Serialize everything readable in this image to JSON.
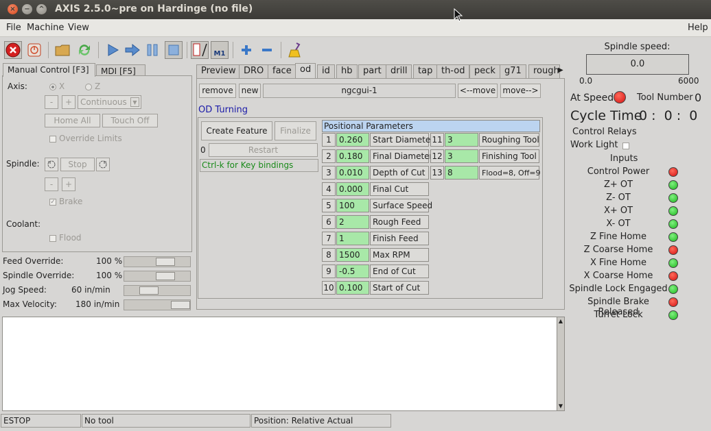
{
  "window": {
    "title": "AXIS 2.5.0~pre on Hardinge (no file)",
    "close": "×",
    "minimize": "−",
    "maximize": "^"
  },
  "menu": {
    "file": "File",
    "machine": "Machine",
    "view": "View",
    "help": "Help"
  },
  "toolbar": {
    "touch_off_label": "M1"
  },
  "left": {
    "tabs": [
      "Manual Control [F3]",
      "MDI [F5]"
    ],
    "axis_label": "Axis:",
    "axis_x": "X",
    "axis_z": "Z",
    "minus": "-",
    "plus": "+",
    "jog_mode": "Continuous",
    "home_all": "Home All",
    "touch_off": "Touch Off",
    "override_limits": "Override Limits",
    "spindle_label": "Spindle:",
    "stop": "Stop",
    "brake": "Brake",
    "coolant_label": "Coolant:",
    "flood": "Flood",
    "check_mark": "✓"
  },
  "overrides": [
    {
      "label": "Feed Override:",
      "value": "100 %"
    },
    {
      "label": "Spindle Override:",
      "value": "100 %"
    },
    {
      "label": "Jog Speed:",
      "value": "60 in/min"
    },
    {
      "label": "Max Velocity:",
      "value": "180 in/min"
    }
  ],
  "center": {
    "tabs": [
      "Preview",
      "DRO",
      "face",
      "od",
      "id",
      "hb",
      "part",
      "drill",
      "tap",
      "th-od",
      "peck",
      "g71",
      "rough"
    ],
    "remove": "remove",
    "new": "new",
    "title_entry": "ngcgui-1",
    "move_left": "<--move",
    "move_right": "move-->",
    "section": "OD Turning",
    "create_feature": "Create Feature",
    "finalize": "Finalize",
    "restart_num": "0",
    "restart": "Restart",
    "keys_hint": "Ctrl-k for Key bindings",
    "params_header": "Positional Parameters",
    "params": [
      {
        "n": "1",
        "v": "0.260",
        "name": "Start Diameter"
      },
      {
        "n": "2",
        "v": "0.180",
        "name": "Final Diameter"
      },
      {
        "n": "3",
        "v": "0.010",
        "name": "Depth of Cut"
      },
      {
        "n": "4",
        "v": "0.000",
        "name": "Final Cut"
      },
      {
        "n": "5",
        "v": "100",
        "name": "Surface Speed"
      },
      {
        "n": "6",
        "v": "2",
        "name": "Rough Feed"
      },
      {
        "n": "7",
        "v": "1",
        "name": "Finish Feed"
      },
      {
        "n": "8",
        "v": "1500",
        "name": "Max RPM"
      },
      {
        "n": "9",
        "v": "-0.5",
        "name": "End of Cut"
      },
      {
        "n": "10",
        "v": "0.100",
        "name": "Start of Cut"
      }
    ],
    "params2": [
      {
        "n": "11",
        "v": "3",
        "name": "Roughing Tool"
      },
      {
        "n": "12",
        "v": "3",
        "name": "Finishing Tool"
      },
      {
        "n": "13",
        "v": "8",
        "name": "Flood=8, Off=9"
      }
    ]
  },
  "status": {
    "estop": "ESTOP",
    "tool": "No tool",
    "position": "Position: Relative Actual"
  },
  "right": {
    "spindle_speed_label": "Spindle speed:",
    "spindle_speed_value": "0.0",
    "scale_min": "0.0",
    "scale_max": "6000",
    "at_speed": "At Speed",
    "tool_number_label": "Tool Number",
    "tool_number": "0",
    "cycle_time_label": "Cycle Time",
    "cycle_time_value": "0 :  0 :  0",
    "control_relays": "Control Relays",
    "work_light": "Work Light",
    "inputs_title": "Inputs",
    "inputs": [
      {
        "label": "Control Power",
        "state": "red"
      },
      {
        "label": "Z+ OT",
        "state": "green"
      },
      {
        "label": "Z- OT",
        "state": "green"
      },
      {
        "label": "X+ OT",
        "state": "green"
      },
      {
        "label": "X- OT",
        "state": "green"
      },
      {
        "label": "Z Fine Home",
        "state": "green"
      },
      {
        "label": "Z Coarse Home",
        "state": "red"
      },
      {
        "label": "X Fine Home",
        "state": "green"
      },
      {
        "label": "X Coarse Home",
        "state": "red"
      },
      {
        "label": "Spindle Lock Engaged",
        "state": "green"
      },
      {
        "label": "Spindle Brake Released",
        "state": "red"
      },
      {
        "label": "Turret Lock",
        "state": "green"
      }
    ]
  },
  "colors": {
    "param_entry": "#a8e8a8",
    "section_title": "#1a1aa8",
    "hint_text": "#1a8a1a",
    "params_header_bg": "#bcd4f0"
  }
}
